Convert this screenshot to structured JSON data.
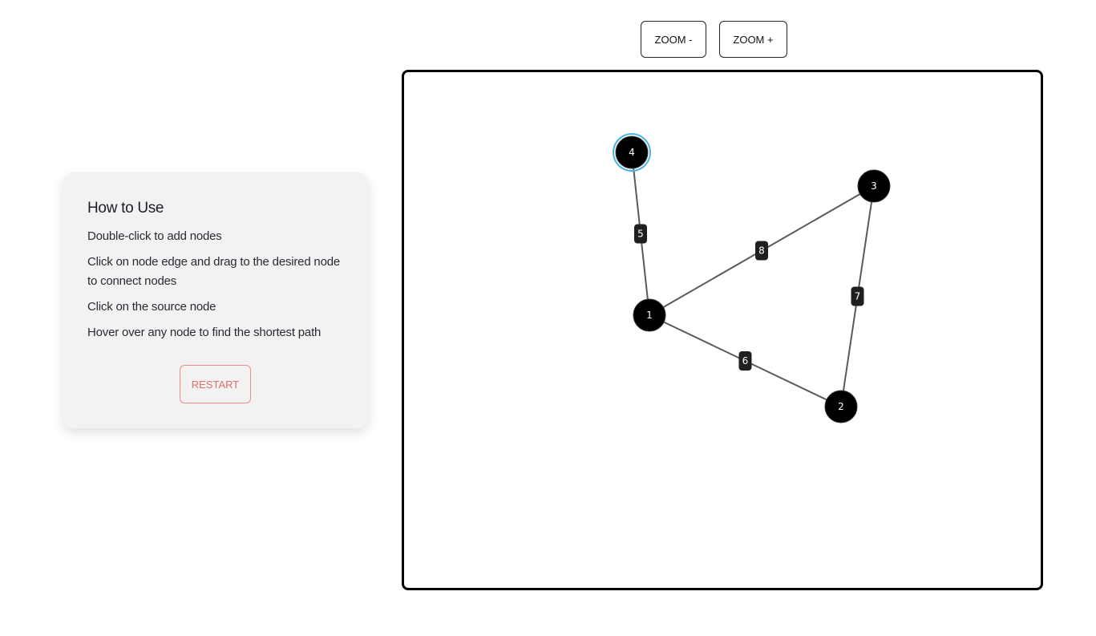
{
  "toolbar": {
    "zoom_out_label": "ZOOM -",
    "zoom_in_label": "ZOOM +"
  },
  "help": {
    "title": "How to Use",
    "instructions": [
      "Double-click to add nodes",
      "Click on node edge and drag to the desired node to connect nodes",
      "Click on the source node",
      "Hover over any node to find the shortest path"
    ],
    "restart_label": "RESTART",
    "restart_color": "#e66a6a"
  },
  "graph": {
    "nodes": [
      {
        "id": "4",
        "label": "4",
        "selected": true
      },
      {
        "id": "3",
        "label": "3",
        "selected": false
      },
      {
        "id": "1",
        "label": "1",
        "selected": false
      },
      {
        "id": "2",
        "label": "2",
        "selected": false
      }
    ],
    "edges": [
      {
        "from": "4",
        "to": "1",
        "weight": "5"
      },
      {
        "from": "1",
        "to": "3",
        "weight": "8"
      },
      {
        "from": "3",
        "to": "2",
        "weight": "7"
      },
      {
        "from": "1",
        "to": "2",
        "weight": "6"
      }
    ],
    "colors": {
      "node_fill": "#000000",
      "node_selected_ring": "#4fb3e0",
      "edge_stroke": "#5a5a5a",
      "edge_label_bg": "#1f1f1f"
    }
  }
}
